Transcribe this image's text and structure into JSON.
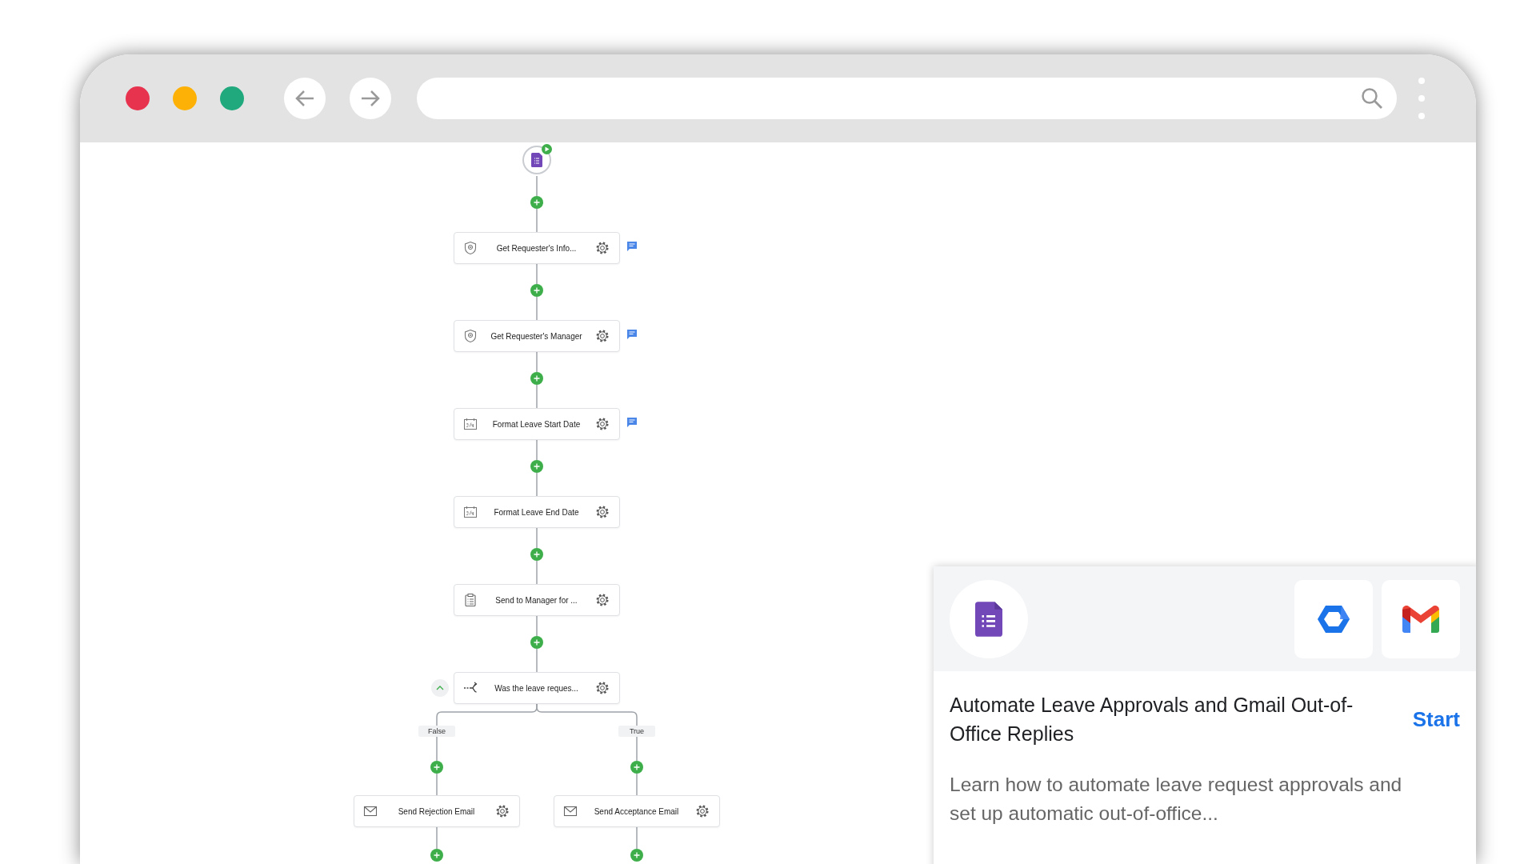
{
  "flow": {
    "trigger": {
      "kind": "forms",
      "running": true
    },
    "steps": [
      {
        "label": "Get Requester's Info...",
        "kind": "shield",
        "note": true
      },
      {
        "label": "Get Requester's Manager",
        "kind": "shield",
        "note": true
      },
      {
        "label": "Format Leave Start Date",
        "kind": "calendar",
        "note": true
      },
      {
        "label": "Format Leave End Date",
        "kind": "calendar",
        "note": false
      },
      {
        "label": "Send to Manager for ...",
        "kind": "clipboard",
        "note": false
      },
      {
        "label": "Was the leave reques...",
        "kind": "branch",
        "note": false,
        "expanded": true
      }
    ],
    "branches": [
      {
        "label": "False",
        "step": {
          "label": "Send Rejection Email",
          "kind": "mail",
          "note": false
        }
      },
      {
        "label": "True",
        "step": {
          "label": "Send Acceptance Email",
          "kind": "mail",
          "note": false
        }
      }
    ]
  },
  "template_card": {
    "apps": [
      {
        "kind": "forms"
      },
      {
        "kind": "workspace"
      },
      {
        "kind": "gmail"
      }
    ],
    "title": "Automate Leave Approvals and Gmail Out-of-Office Replies",
    "action": "Start",
    "description": "Learn how to automate leave request approvals and set up automatic out-of-office..."
  }
}
